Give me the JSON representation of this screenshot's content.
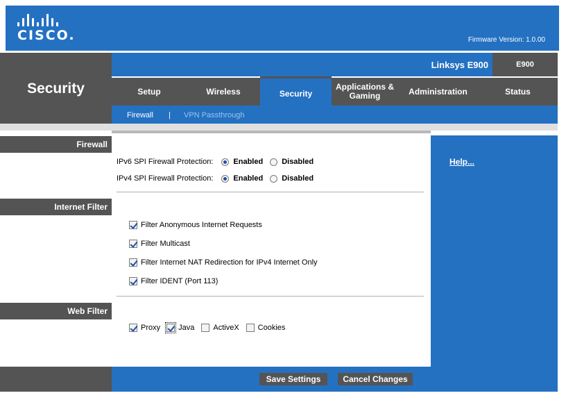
{
  "header": {
    "logo_text": "CISCO.",
    "firmware": "Firmware Version: 1.0.00"
  },
  "page_title": "Security",
  "model": {
    "name": "Linksys E900",
    "code": "E900"
  },
  "tabs": [
    {
      "label": "Setup",
      "active": false
    },
    {
      "label": "Wireless",
      "active": false
    },
    {
      "label": "Security",
      "active": true
    },
    {
      "label": "Applications & Gaming",
      "active": false
    },
    {
      "label": "Administration",
      "active": false
    },
    {
      "label": "Status",
      "active": false
    }
  ],
  "subnav": {
    "firewall": "Firewall",
    "separator": "|",
    "vpn": "VPN Passthrough"
  },
  "sections": {
    "firewall": "Firewall",
    "internet_filter": "Internet Filter",
    "web_filter": "Web Filter"
  },
  "firewall": {
    "ipv6_label": "IPv6 SPI Firewall  Protection:",
    "ipv4_label": "IPv4 SPI Firewall  Protection:",
    "enabled": "Enabled",
    "disabled": "Disabled",
    "ipv6_value": "Enabled",
    "ipv4_value": "Enabled"
  },
  "internet_filter": {
    "items": [
      {
        "label": "Filter Anonymous Internet Requests",
        "checked": true
      },
      {
        "label": "Filter Multicast",
        "checked": true
      },
      {
        "label": "Filter Internet NAT Redirection for IPv4 Internet Only",
        "checked": true
      },
      {
        "label": "Filter IDENT (Port 113)",
        "checked": true
      }
    ]
  },
  "web_filter": {
    "items": [
      {
        "label": "Proxy",
        "checked": true
      },
      {
        "label": "Java",
        "checked": true
      },
      {
        "label": "ActiveX",
        "checked": false
      },
      {
        "label": "Cookies",
        "checked": false
      }
    ]
  },
  "help": "Help...",
  "buttons": {
    "save": "Save Settings",
    "cancel": "Cancel Changes"
  },
  "colors": {
    "blue": "#2471c2",
    "gray": "#545454"
  }
}
